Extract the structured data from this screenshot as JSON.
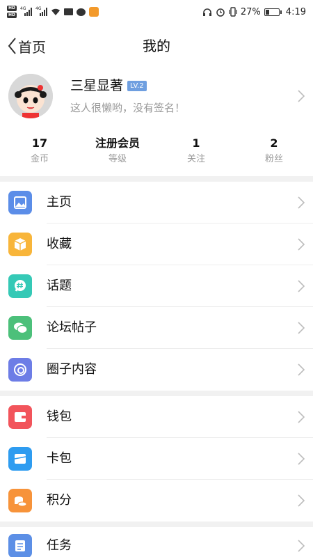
{
  "status_bar": {
    "time": "4:19",
    "battery": "27%",
    "net_left": "HD",
    "gen": "4G"
  },
  "header": {
    "back_label": "首页",
    "title": "我的"
  },
  "profile": {
    "name": "三星显著",
    "level_badge": "LV.2",
    "bio": "这人很懒哟，没有签名！"
  },
  "stats": [
    {
      "value": "17",
      "label": "金币"
    },
    {
      "value": "注册会员",
      "label": "等级"
    },
    {
      "value": "1",
      "label": "关注"
    },
    {
      "value": "2",
      "label": "粉丝"
    }
  ],
  "menu": {
    "group1": [
      {
        "label": "主页",
        "icon": "picture-icon",
        "color": "#5b8de8"
      },
      {
        "label": "收藏",
        "icon": "box-icon",
        "color": "#f8b53a"
      },
      {
        "label": "话题",
        "icon": "hashtag-bubble-icon",
        "color": "#35c9b6"
      },
      {
        "label": "论坛帖子",
        "icon": "chat-bubbles-icon",
        "color": "#4cc07a"
      },
      {
        "label": "圈子内容",
        "icon": "spiral-icon",
        "color": "#6d7de6"
      }
    ],
    "group2": [
      {
        "label": "钱包",
        "icon": "wallet-icon",
        "color": "#f2545b"
      },
      {
        "label": "卡包",
        "icon": "card-icon",
        "color": "#2e9cf0"
      },
      {
        "label": "积分",
        "icon": "coins-icon",
        "color": "#f7933a"
      }
    ],
    "group3": [
      {
        "label": "任务",
        "icon": "task-list-icon",
        "color": "#5c8fe6"
      }
    ]
  }
}
